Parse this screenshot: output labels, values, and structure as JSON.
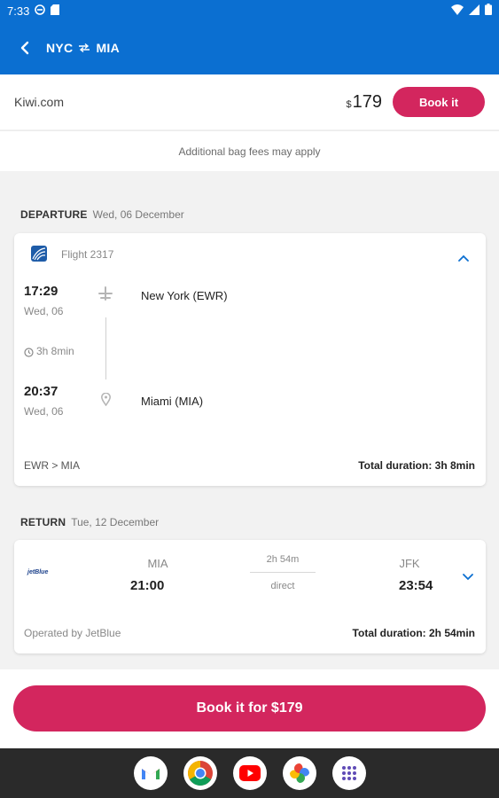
{
  "status_bar": {
    "time": "7:33"
  },
  "header": {
    "origin": "NYC",
    "destination": "MIA"
  },
  "provider": {
    "name": "Kiwi.com",
    "currency": "$",
    "price": "179",
    "book_label": "Book it"
  },
  "bag_note": "Additional bag fees may apply",
  "departure": {
    "label": "DEPARTURE",
    "date": "Wed, 06 December",
    "flight_label": "Flight 2317",
    "dep_time": "17:29",
    "dep_day": "Wed, 06",
    "dep_place": "New York (EWR)",
    "duration": "3h 8min",
    "arr_time": "20:37",
    "arr_day": "Wed, 06",
    "arr_place": "Miami (MIA)",
    "route": "EWR > MIA",
    "total_duration": "Total duration: 3h 8min"
  },
  "return": {
    "label": "RETURN",
    "date": "Tue, 12 December",
    "airline_logo_text": "jetBlue",
    "from_code": "MIA",
    "from_time": "21:00",
    "duration": "2h 54m",
    "stops": "direct",
    "to_code": "JFK",
    "to_time": "23:54",
    "operated_by": "Operated by JetBlue",
    "total_duration": "Total duration: 2h 54min"
  },
  "bottom": {
    "book_label": "Book it for $179"
  },
  "colors": {
    "primary_blue": "#0b6fd1",
    "accent_pink": "#d3265e"
  },
  "icons": [
    "dnd-icon",
    "sd-card-icon",
    "wifi-icon",
    "signal-icon",
    "battery-icon",
    "back-arrow-icon",
    "round-trip-icon",
    "airline-logo-icon",
    "plane-icon",
    "clock-icon",
    "location-pin-icon",
    "chevron-up-icon",
    "chevron-down-icon",
    "gmail-icon",
    "chrome-icon",
    "youtube-icon",
    "photos-icon",
    "app-drawer-icon"
  ]
}
